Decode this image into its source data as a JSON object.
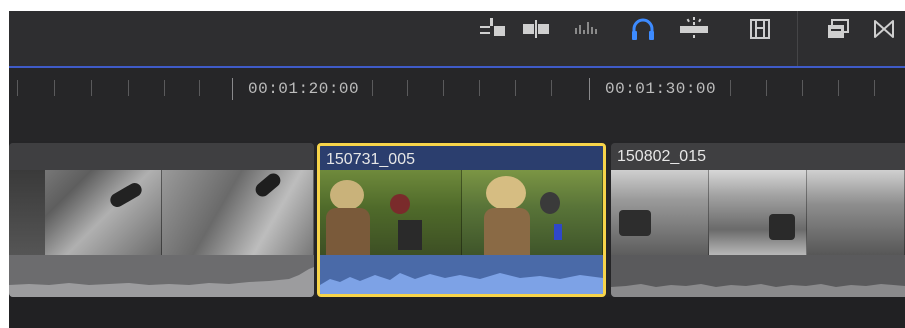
{
  "ruler": {
    "timecode_1": "00:01:20:00",
    "timecode_2": "00:01:30:00"
  },
  "clips": [
    {
      "name": "",
      "style": "grey"
    },
    {
      "name": "150731_005",
      "selected": true,
      "style": "color"
    },
    {
      "name": "150802_015",
      "style": "grey"
    }
  ],
  "toolbar": {
    "icons": [
      "connect-clip-icon",
      "insert-clip-icon",
      "audio-skimming-icon",
      "headphones-solo-icon",
      "snapping-icon",
      "filmstrip-icon",
      "clip-appearance-icon",
      "transitions-icon"
    ],
    "headphones_active_color": "#3d8bff"
  },
  "colors": {
    "selection": "#f7d44a",
    "clip_selected_title_bg": "#2b3e6e",
    "audio_selected": "#4a6aa8",
    "audio_grey": "#545456"
  }
}
